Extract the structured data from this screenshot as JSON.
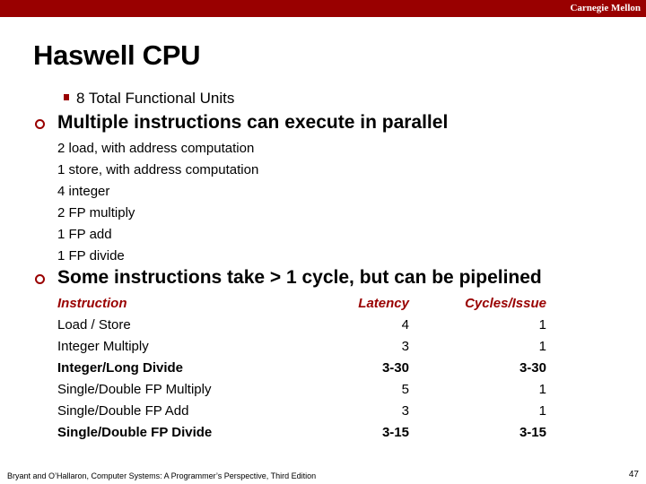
{
  "header": {
    "brand": "Carnegie Mellon"
  },
  "slide": {
    "title": "Haswell CPU",
    "sub_bullet": "8 Total Functional Units",
    "bullets": [
      "Multiple instructions can execute in parallel",
      "Some instructions take > 1 cycle, but can be pipelined"
    ],
    "units": [
      "2 load, with address computation",
      "1 store, with address computation",
      "4 integer",
      "2 FP multiply",
      "1 FP add",
      "1 FP divide"
    ],
    "table": {
      "headers": [
        "Instruction",
        "Latency",
        "Cycles/Issue"
      ],
      "rows": [
        {
          "instruction": "Load / Store",
          "latency": "4",
          "cycles": "1",
          "bold": false
        },
        {
          "instruction": "Integer Multiply",
          "latency": "3",
          "cycles": "1",
          "bold": false
        },
        {
          "instruction": "Integer/Long Divide",
          "latency": "3-30",
          "cycles": "3-30",
          "bold": true
        },
        {
          "instruction": "Single/Double FP Multiply",
          "latency": "5",
          "cycles": "1",
          "bold": false
        },
        {
          "instruction": "Single/Double FP Add",
          "latency": "3",
          "cycles": "1",
          "bold": false
        },
        {
          "instruction": "Single/Double FP Divide",
          "latency": "3-15",
          "cycles": "3-15",
          "bold": true
        }
      ]
    }
  },
  "footer": {
    "citation": "Bryant and O’Hallaron, Computer Systems: A Programmer’s Perspective, Third Edition",
    "page_number": "47"
  },
  "colors": {
    "accent": "#990000"
  }
}
